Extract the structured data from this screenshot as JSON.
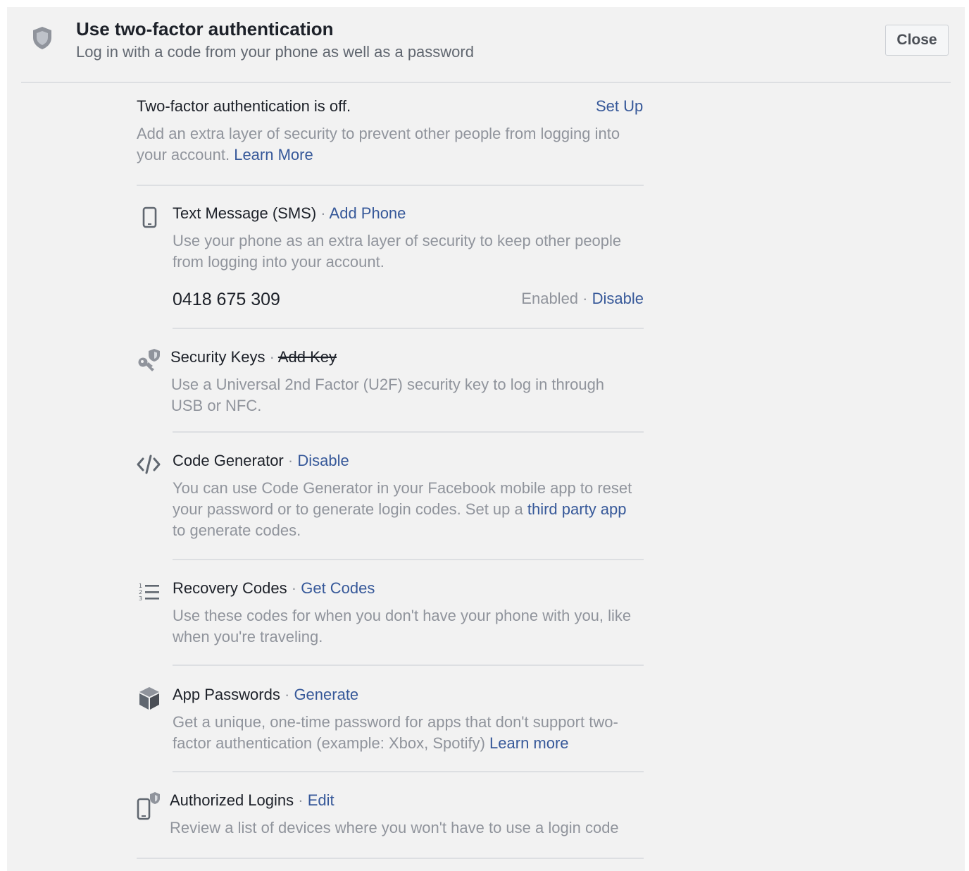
{
  "header": {
    "title": "Use two-factor authentication",
    "subtitle": "Log in with a code from your phone as well as a password",
    "close_label": "Close",
    "icon": "shield-icon"
  },
  "status": {
    "title": "Two-factor authentication is off.",
    "setup_link": "Set Up",
    "description_part1": "Add an extra layer of security to prevent other people from logging into",
    "description_part2": "your account.",
    "learn_more": "Learn More"
  },
  "sms": {
    "icon": "phone-icon",
    "title": "Text Message (SMS)",
    "separator": "·",
    "action": "Add Phone",
    "description_line1": "Use your phone as an extra layer of security to keep other people",
    "description_line2": "from logging into your account.",
    "phone_number": "0418 675 309",
    "enabled_label": "Enabled",
    "disable_label": "Disable"
  },
  "security_keys": {
    "icon": "security-key-icon",
    "title": "Security Keys",
    "separator": "·",
    "action": "Add Key",
    "description_line1": "Use a Universal 2nd Factor (U2F) security key to log in through",
    "description_line2": "USB or NFC."
  },
  "code_generator": {
    "icon": "code-icon",
    "title": "Code Generator",
    "separator": "·",
    "action": "Disable",
    "description_line1": "You can use Code Generator in your Facebook mobile app to reset",
    "description_line2_prefix": "your password or to generate login codes. Set up a",
    "third_party_link": "third party app",
    "description_line3": "to generate codes."
  },
  "recovery_codes": {
    "icon": "numbered-list-icon",
    "title": "Recovery Codes",
    "separator": "·",
    "action": "Get Codes",
    "description_line1": "Use these codes for when you don't have your phone with you, like",
    "description_line2": "when you're traveling."
  },
  "app_passwords": {
    "icon": "cube-icon",
    "title": "App Passwords",
    "separator": "·",
    "action": "Generate",
    "description_line1": "Get a unique, one-time password for apps that don't support two-",
    "description_line2": "factor authentication (example: Xbox, Spotify)",
    "learn_more": "Learn more"
  },
  "authorized_logins": {
    "icon": "device-shield-icon",
    "title": "Authorized Logins",
    "separator": "·",
    "action": "Edit",
    "description": "Review a list of devices where you won't have to use a login code"
  }
}
